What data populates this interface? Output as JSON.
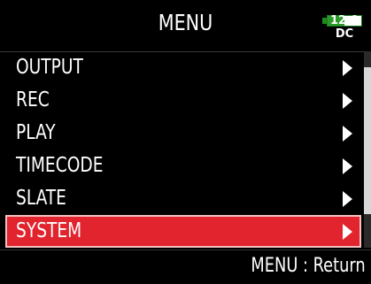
{
  "header": {
    "title": "MENU",
    "battery": {
      "level_text": "12.0",
      "source": "DC",
      "fill_fraction": 0.5,
      "fill_color": "#2b9a2b"
    }
  },
  "menu": {
    "items": [
      {
        "label": "OUTPUT",
        "selected": false
      },
      {
        "label": "REC",
        "selected": false
      },
      {
        "label": "PLAY",
        "selected": false
      },
      {
        "label": "TIMECODE",
        "selected": false
      },
      {
        "label": "SLATE",
        "selected": false
      },
      {
        "label": "SYSTEM",
        "selected": true
      }
    ],
    "selected_color": "#e1242d"
  },
  "scrollbar": {
    "position_fraction": 0.08,
    "visible_fraction": 0.75
  },
  "footer": {
    "hint": "MENU : Return"
  }
}
